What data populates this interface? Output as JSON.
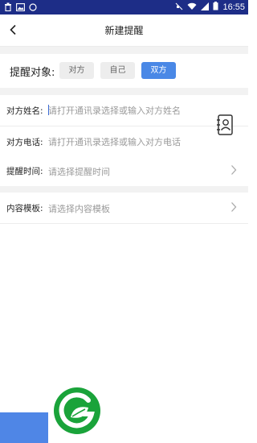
{
  "status_bar": {
    "time": "16:55"
  },
  "header": {
    "title": "新建提醒"
  },
  "target": {
    "label": "提醒对象:",
    "options": [
      "对方",
      "自己",
      "双方"
    ],
    "selected": "双方"
  },
  "form": {
    "name": {
      "label": "对方姓名:",
      "placeholder": "请打开通讯录选择或输入对方姓名"
    },
    "phone": {
      "label": "对方电话:",
      "placeholder": "请打开通讯录选择或输入对方电话"
    },
    "time": {
      "label": "提醒时间:",
      "placeholder": "请选择提醒时间"
    },
    "template": {
      "label": "内容模板:",
      "placeholder": "请选择内容模板"
    }
  },
  "colors": {
    "status_bar": "#1d2d87",
    "accent": "#4a88e6",
    "logo_green": "#1aa33a"
  }
}
